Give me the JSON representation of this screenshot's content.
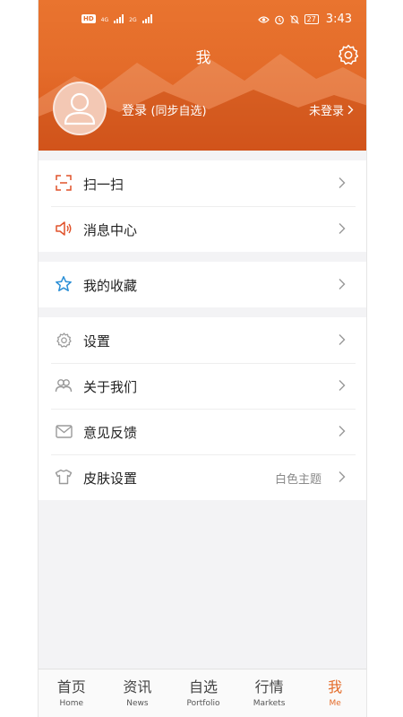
{
  "status": {
    "left": {
      "hd": "HD",
      "net1": "4G",
      "net2": "2G"
    },
    "battery": "27",
    "time": "3:43"
  },
  "header": {
    "title": "我",
    "login_label": "登录",
    "login_sub": "(同步自选)",
    "not_logged_in": "未登录"
  },
  "groups": [
    {
      "items": [
        {
          "label": "扫一扫",
          "icon": "scan-icon",
          "color": "#e0522a"
        },
        {
          "label": "消息中心",
          "icon": "speaker-icon",
          "color": "#e0522a"
        }
      ]
    },
    {
      "items": [
        {
          "label": "我的收藏",
          "icon": "star-icon",
          "color": "#2b8fd6"
        }
      ]
    },
    {
      "items": [
        {
          "label": "设置",
          "icon": "gear-icon",
          "color": "#9a9a9a"
        },
        {
          "label": "关于我们",
          "icon": "people-icon",
          "color": "#9a9a9a"
        },
        {
          "label": "意见反馈",
          "icon": "mail-icon",
          "color": "#9a9a9a"
        },
        {
          "label": "皮肤设置",
          "icon": "shirt-icon",
          "color": "#9a9a9a",
          "value": "白色主题"
        }
      ]
    }
  ],
  "tabs": [
    {
      "cn": "首页",
      "en": "Home"
    },
    {
      "cn": "资讯",
      "en": "News"
    },
    {
      "cn": "自选",
      "en": "Portfolio"
    },
    {
      "cn": "行情",
      "en": "Markets"
    },
    {
      "cn": "我",
      "en": "Me",
      "active": true
    }
  ],
  "colors": {
    "accent": "#e46c2a",
    "background": "#f3f3f5"
  }
}
